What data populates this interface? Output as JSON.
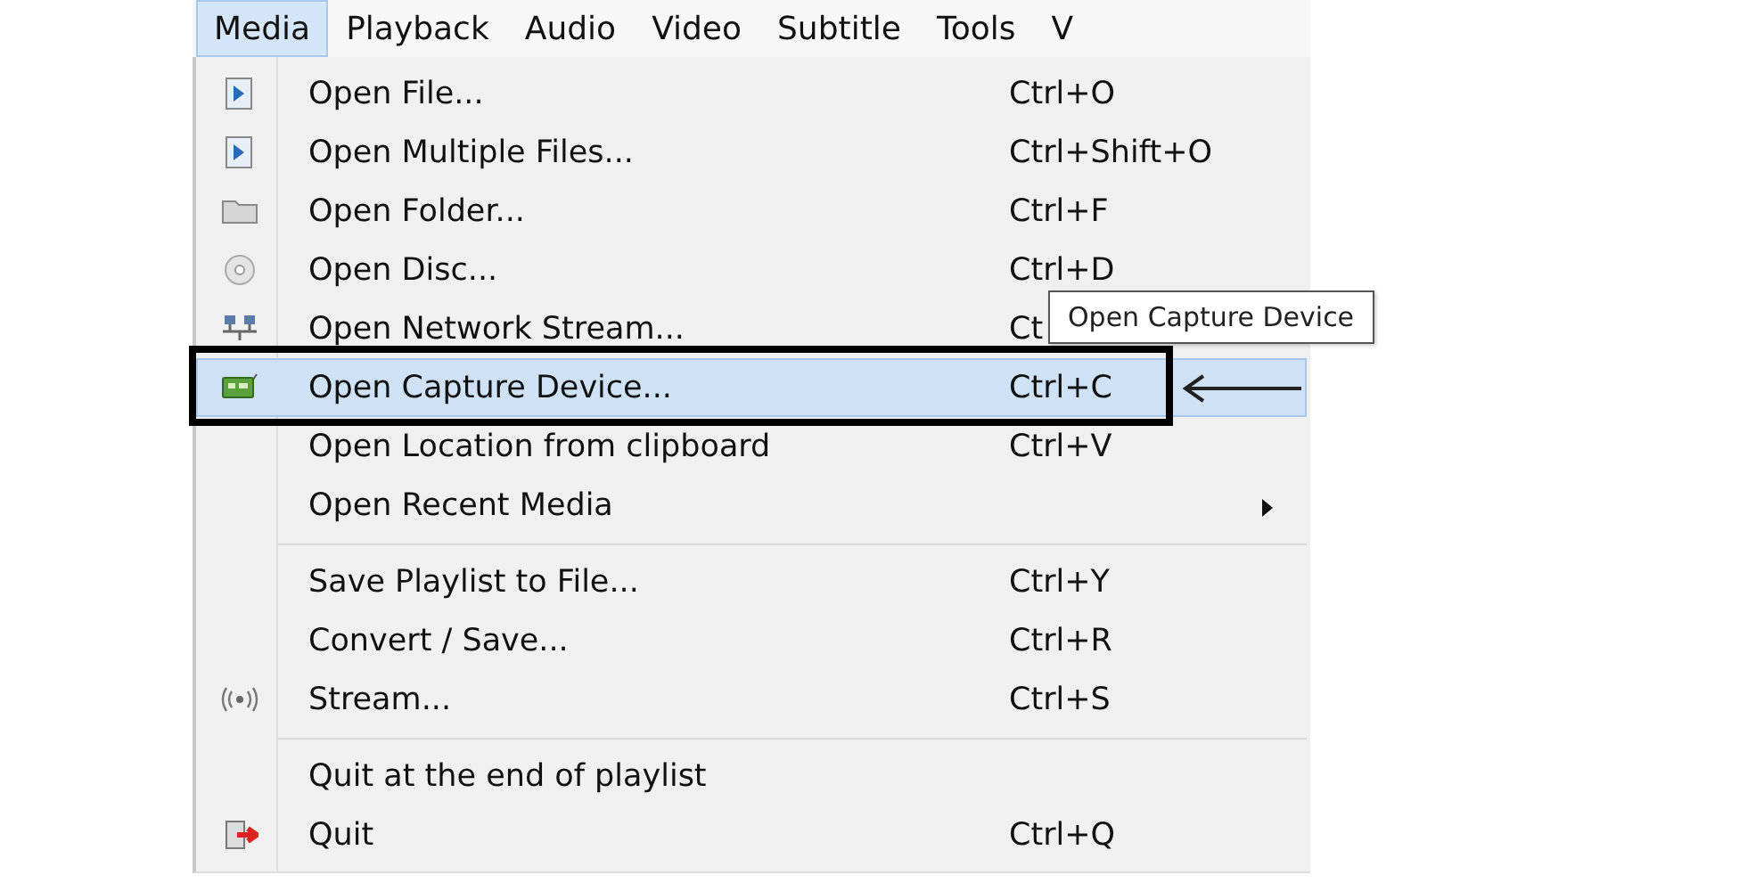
{
  "menubar": [
    {
      "label": "Media",
      "selected": true
    },
    {
      "label": "Playback",
      "selected": false
    },
    {
      "label": "Audio",
      "selected": false
    },
    {
      "label": "Video",
      "selected": false
    },
    {
      "label": "Subtitle",
      "selected": false
    },
    {
      "label": "Tools",
      "selected": false
    },
    {
      "label": "V",
      "selected": false
    }
  ],
  "menu": [
    {
      "kind": "item",
      "label": "Open File...",
      "shortcut": "Ctrl+O",
      "selected": false,
      "submenu": false
    },
    {
      "kind": "item",
      "label": "Open Multiple Files...",
      "shortcut": "Ctrl+Shift+O",
      "selected": false,
      "submenu": false
    },
    {
      "kind": "item",
      "label": "Open Folder...",
      "shortcut": "Ctrl+F",
      "selected": false,
      "submenu": false
    },
    {
      "kind": "item",
      "label": "Open Disc...",
      "shortcut": "Ctrl+D",
      "selected": false,
      "submenu": false
    },
    {
      "kind": "item",
      "label": "Open Network Stream...",
      "shortcut": "Ct",
      "selected": false,
      "submenu": false
    },
    {
      "kind": "item",
      "label": "Open Capture Device...",
      "shortcut": "Ctrl+C",
      "selected": true,
      "submenu": false
    },
    {
      "kind": "item",
      "label": "Open Location from clipboard",
      "shortcut": "Ctrl+V",
      "selected": false,
      "submenu": false
    },
    {
      "kind": "item",
      "label": "Open Recent Media",
      "selected": false,
      "submenu": true
    },
    {
      "kind": "separator"
    },
    {
      "kind": "item",
      "label": "Save Playlist to File...",
      "shortcut": "Ctrl+Y",
      "selected": false,
      "submenu": false
    },
    {
      "kind": "item",
      "label": "Convert / Save...",
      "shortcut": "Ctrl+R",
      "selected": false,
      "submenu": false
    },
    {
      "kind": "item",
      "label": "Stream...",
      "shortcut": "Ctrl+S",
      "selected": false,
      "submenu": false
    },
    {
      "kind": "separator"
    },
    {
      "kind": "item",
      "label": "Quit at the end of playlist",
      "selected": false,
      "submenu": false
    },
    {
      "kind": "item",
      "label": "Quit",
      "shortcut": "Ctrl+Q",
      "selected": false,
      "submenu": false
    }
  ],
  "tooltip": {
    "text": "Open Capture Device"
  }
}
